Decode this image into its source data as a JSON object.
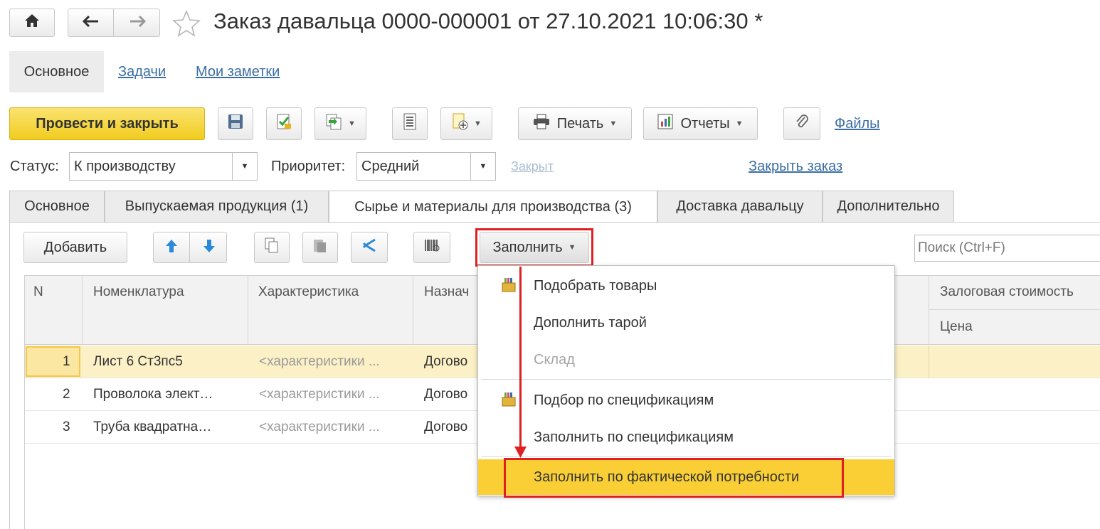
{
  "window": {
    "title": "Заказ давальца 0000-000001 от 27.10.2021 10:06:30 *"
  },
  "top_nav": {
    "section_main": "Основное",
    "tasks": "Задачи",
    "notes": "Мои заметки"
  },
  "toolbar": {
    "post_close": "Провести и закрыть",
    "print": "Печать",
    "reports": "Отчеты",
    "files": "Файлы"
  },
  "fields": {
    "status_label": "Статус:",
    "status_value": "К производству",
    "priority_label": "Приоритет:",
    "priority_value": "Средний",
    "closed_link": "Закрыт",
    "close_order": "Закрыть заказ"
  },
  "tabs": [
    {
      "label": "Основное"
    },
    {
      "label": "Выпускаемая продукция (1)"
    },
    {
      "label": "Сырье и материалы для производства (3)"
    },
    {
      "label": "Доставка давальцу"
    },
    {
      "label": "Дополнительно"
    }
  ],
  "table_toolbar": {
    "add": "Добавить",
    "fill": "Заполнить",
    "search_placeholder": "Поиск (Ctrl+F)"
  },
  "table": {
    "headers": {
      "n": "N",
      "item": "Номенклатура",
      "char": "Характеристика",
      "purpose": "Назнач",
      "deposit": "Залоговая стоимость",
      "price": "Цена"
    },
    "rows": [
      {
        "n": "1",
        "item": "Лист 6 Ст3пс5",
        "char": "<характеристики ...",
        "purpose": "Догово"
      },
      {
        "n": "2",
        "item": "Проволока элект…",
        "char": "<характеристики ...",
        "purpose": "Догово"
      },
      {
        "n": "3",
        "item": "Труба квадратна…",
        "char": "<характеристики ...",
        "purpose": "Догово"
      }
    ]
  },
  "fill_menu": {
    "items": [
      {
        "label": "Подобрать товары"
      },
      {
        "label": "Дополнить тарой"
      },
      {
        "label": "Склад"
      },
      {
        "label": "Подбор по спецификациям"
      },
      {
        "label": "Заполнить по спецификациям"
      },
      {
        "label": "Заполнить по фактической потребности"
      }
    ]
  },
  "colors": {
    "primary_button": "#f5d43c",
    "selected_row": "#fbf0c6",
    "menu_highlight": "#f9cf35",
    "annotation_red": "#e02020",
    "link": "#3b6ea5"
  }
}
